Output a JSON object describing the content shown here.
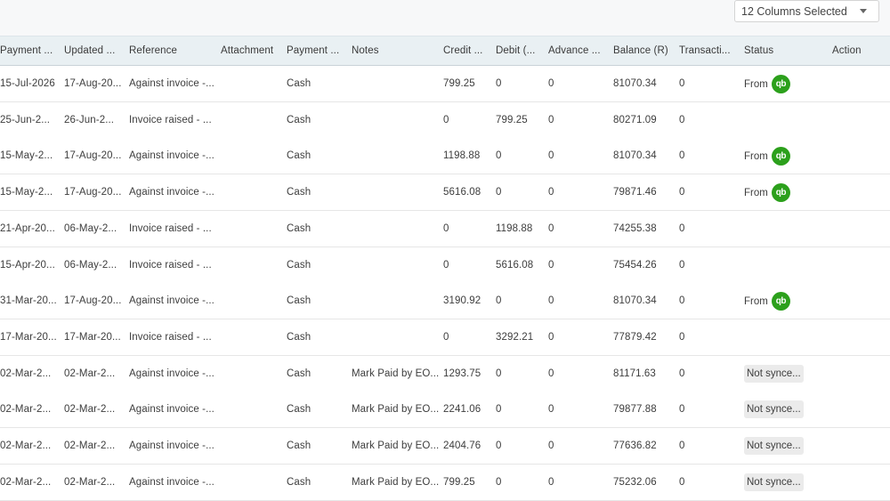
{
  "toolbar": {
    "column_selector_label": "12 Columns Selected"
  },
  "columns": [
    {
      "key": "payment_date",
      "label": "Payment ..."
    },
    {
      "key": "updated",
      "label": "Updated ..."
    },
    {
      "key": "reference",
      "label": "Reference"
    },
    {
      "key": "attachment",
      "label": "Attachment"
    },
    {
      "key": "payment_mode",
      "label": "Payment ..."
    },
    {
      "key": "notes",
      "label": "Notes"
    },
    {
      "key": "credit",
      "label": "Credit ..."
    },
    {
      "key": "debit",
      "label": "Debit (..."
    },
    {
      "key": "advance",
      "label": "Advance ..."
    },
    {
      "key": "balance",
      "label": "Balance (R)"
    },
    {
      "key": "transaction",
      "label": "Transacti..."
    },
    {
      "key": "status",
      "label": "Status"
    },
    {
      "key": "action",
      "label": "Action"
    }
  ],
  "status_labels": {
    "synced_prefix": "From",
    "qb_logo_text": "qb"
  },
  "rows": [
    {
      "payment_date": "15-Jul-2026",
      "updated": "17-Aug-20...",
      "reference": "Against invoice -...",
      "attachment": "",
      "payment_mode": "Cash",
      "notes": "",
      "credit": "799.25",
      "debit": "0",
      "advance": "0",
      "balance": "81070.34",
      "transaction": "0",
      "status_type": "synced",
      "status_text": ""
    },
    {
      "payment_date": "25-Jun-2...",
      "updated": "26-Jun-2...",
      "reference": "Invoice raised - ...",
      "attachment": "",
      "payment_mode": "Cash",
      "notes": "",
      "credit": "0",
      "debit": "799.25",
      "advance": "0",
      "balance": "80271.09",
      "transaction": "0",
      "status_type": "none",
      "status_text": ""
    },
    {
      "payment_date": "15-May-2...",
      "updated": "17-Aug-20...",
      "reference": "Against invoice -...",
      "attachment": "",
      "payment_mode": "Cash",
      "notes": "",
      "credit": "1198.88",
      "debit": "0",
      "advance": "0",
      "balance": "81070.34",
      "transaction": "0",
      "status_type": "synced",
      "status_text": ""
    },
    {
      "payment_date": "15-May-2...",
      "updated": "17-Aug-20...",
      "reference": "Against invoice -...",
      "attachment": "",
      "payment_mode": "Cash",
      "notes": "",
      "credit": "5616.08",
      "debit": "0",
      "advance": "0",
      "balance": "79871.46",
      "transaction": "0",
      "status_type": "synced",
      "status_text": ""
    },
    {
      "payment_date": "21-Apr-20...",
      "updated": "06-May-2...",
      "reference": "Invoice raised - ...",
      "attachment": "",
      "payment_mode": "Cash",
      "notes": "",
      "credit": "0",
      "debit": "1198.88",
      "advance": "0",
      "balance": "74255.38",
      "transaction": "0",
      "status_type": "none",
      "status_text": ""
    },
    {
      "payment_date": "15-Apr-20...",
      "updated": "06-May-2...",
      "reference": "Invoice raised - ...",
      "attachment": "",
      "payment_mode": "Cash",
      "notes": "",
      "credit": "0",
      "debit": "5616.08",
      "advance": "0",
      "balance": "75454.26",
      "transaction": "0",
      "status_type": "none",
      "status_text": ""
    },
    {
      "payment_date": "31-Mar-20...",
      "updated": "17-Aug-20...",
      "reference": "Against invoice -...",
      "attachment": "",
      "payment_mode": "Cash",
      "notes": "",
      "credit": "3190.92",
      "debit": "0",
      "advance": "0",
      "balance": "81070.34",
      "transaction": "0",
      "status_type": "synced",
      "status_text": ""
    },
    {
      "payment_date": "17-Mar-20...",
      "updated": "17-Mar-20...",
      "reference": "Invoice raised - ...",
      "attachment": "",
      "payment_mode": "Cash",
      "notes": "",
      "credit": "0",
      "debit": "3292.21",
      "advance": "0",
      "balance": "77879.42",
      "transaction": "0",
      "status_type": "none",
      "status_text": ""
    },
    {
      "payment_date": "02-Mar-2...",
      "updated": "02-Mar-2...",
      "reference": "Against invoice -...",
      "attachment": "",
      "payment_mode": "Cash",
      "notes": "Mark Paid by EO...",
      "credit": "1293.75",
      "debit": "0",
      "advance": "0",
      "balance": "81171.63",
      "transaction": "0",
      "status_type": "badge",
      "status_text": "Not synce..."
    },
    {
      "payment_date": "02-Mar-2...",
      "updated": "02-Mar-2...",
      "reference": "Against invoice -...",
      "attachment": "",
      "payment_mode": "Cash",
      "notes": "Mark Paid by EO...",
      "credit": "2241.06",
      "debit": "0",
      "advance": "0",
      "balance": "79877.88",
      "transaction": "0",
      "status_type": "badge",
      "status_text": "Not synce..."
    },
    {
      "payment_date": "02-Mar-2...",
      "updated": "02-Mar-2...",
      "reference": "Against invoice -...",
      "attachment": "",
      "payment_mode": "Cash",
      "notes": "Mark Paid by EO...",
      "credit": "2404.76",
      "debit": "0",
      "advance": "0",
      "balance": "77636.82",
      "transaction": "0",
      "status_type": "badge",
      "status_text": "Not synce..."
    },
    {
      "payment_date": "02-Mar-2...",
      "updated": "02-Mar-2...",
      "reference": "Against invoice -...",
      "attachment": "",
      "payment_mode": "Cash",
      "notes": "Mark Paid by EO...",
      "credit": "799.25",
      "debit": "0",
      "advance": "0",
      "balance": "75232.06",
      "transaction": "0",
      "status_type": "badge",
      "status_text": "Not synce..."
    }
  ],
  "colors": {
    "header_bg": "#e9f0f3",
    "quickbooks_green": "#2ca01c",
    "badge_bg": "#ebebeb"
  }
}
